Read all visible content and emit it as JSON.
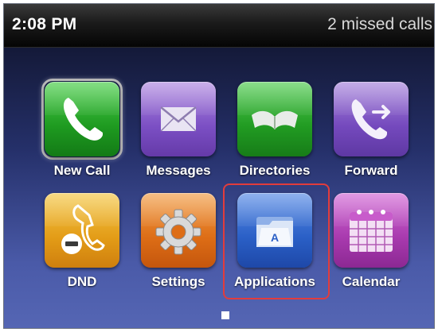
{
  "status_bar": {
    "time": "2:08 PM",
    "missed_calls": "2 missed calls"
  },
  "apps": [
    {
      "label": "New Call",
      "icon": "phone-handset-icon",
      "color": "#1e9a20"
    },
    {
      "label": "Messages",
      "icon": "envelope-icon",
      "color": "#7b4fc4"
    },
    {
      "label": "Directories",
      "icon": "open-book-icon",
      "color": "#219b22"
    },
    {
      "label": "Forward",
      "icon": "call-forward-icon",
      "color": "#7449bd"
    },
    {
      "label": "DND",
      "icon": "do-not-disturb-icon",
      "color": "#e39c17"
    },
    {
      "label": "Settings",
      "icon": "gear-icon",
      "color": "#dd6d16"
    },
    {
      "label": "Applications",
      "icon": "applications-folder-icon",
      "color": "#2a5fc6"
    },
    {
      "label": "Calendar",
      "icon": "calendar-icon",
      "color": "#a83aae"
    }
  ],
  "focused_app": "New Call",
  "highlighted_app": "Applications",
  "highlight_color": "#e23c3c",
  "page_indicator": {
    "current": 1,
    "total": 1
  }
}
